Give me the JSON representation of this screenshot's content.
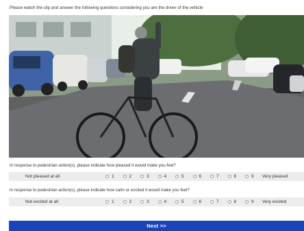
{
  "instruction": "Please watch the clip and answer the following questions considering you are the driver of the vehicle",
  "questions": [
    {
      "text": "In response to pedestrian action(s), please indicate how pleased  it would make you feel?",
      "left_label": "Not pleased at all",
      "right_label": "Very pleased",
      "options": [
        "1",
        "2",
        "3",
        "4",
        "5",
        "6",
        "7",
        "8",
        "9"
      ]
    },
    {
      "text": "In response to pedestrian action(s), please indicate how calm or excited it would make you feel?",
      "left_label": "Not excited at all",
      "right_label": "Very excited",
      "options": [
        "1",
        "2",
        "3",
        "4",
        "5",
        "6",
        "7",
        "8",
        "9"
      ]
    }
  ],
  "next_label": "Next   >>",
  "colors": {
    "next_bar": "#1b44b8",
    "scale_row_bg": "#ececec"
  }
}
